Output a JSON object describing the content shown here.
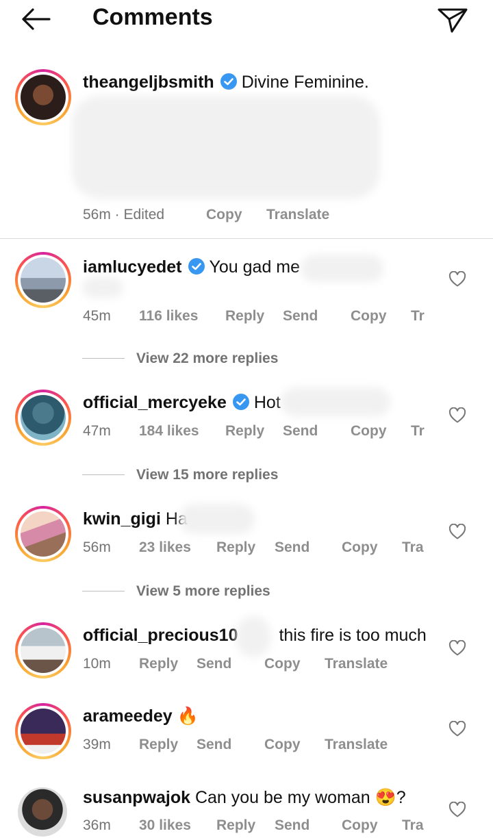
{
  "header": {
    "title": "Comments",
    "back_icon": "arrow-left-icon",
    "share_icon": "paper-plane-icon"
  },
  "caption": {
    "username": "theangeljbsmith",
    "text": "Divine Feminine.",
    "time": "56m · Edited",
    "copy": "Copy",
    "translate": "Translate"
  },
  "comments": [
    {
      "username": "iamlucyedet",
      "text": "You gad me",
      "time": "45m",
      "likes": "116 likes",
      "reply": "Reply",
      "send": "Send",
      "copy": "Copy",
      "translate": "Tr",
      "view_replies": "View 22 more replies"
    },
    {
      "username": "official_mercyeke",
      "text": "Hot",
      "time": "47m",
      "likes": "184 likes",
      "reply": "Reply",
      "send": "Send",
      "copy": "Copy",
      "translate": "Tr",
      "view_replies": "View 15 more replies"
    },
    {
      "username": "kwin_gigi",
      "text": "Ha",
      "time": "56m",
      "likes": "23 likes",
      "reply": "Reply",
      "send": "Send",
      "copy": "Copy",
      "translate": "Tra",
      "view_replies": "View 5 more replies"
    },
    {
      "username": "official_precious10",
      "text": "this fire is too much",
      "time": "10m",
      "reply": "Reply",
      "send": "Send",
      "copy": "Copy",
      "translate": "Translate"
    },
    {
      "username": "arameedey",
      "text": "🔥",
      "time": "39m",
      "reply": "Reply",
      "send": "Send",
      "copy": "Copy",
      "translate": "Translate"
    },
    {
      "username": "susanpwajok",
      "text": "Can you be my woman 😍?",
      "time": "36m",
      "likes": "30 likes",
      "reply": "Reply",
      "send": "Send",
      "copy": "Copy",
      "translate": "Tra"
    }
  ],
  "colors": {
    "verified": "#3897f0",
    "meta": "#737373",
    "divider": "#dbdbdb"
  }
}
